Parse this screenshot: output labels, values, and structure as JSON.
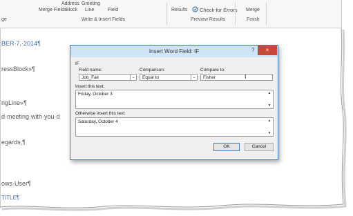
{
  "ribbon": {
    "top_labels": [
      "Merge Fields",
      "Block",
      "Line",
      "Field",
      "Results",
      "Check for Errors",
      "Merge"
    ],
    "top_cut": [
      "Address",
      "Greeting"
    ],
    "groups": [
      "ge",
      "Write & Insert Fields",
      "Preview Results",
      "Finish"
    ]
  },
  "document": {
    "lines": [
      "BER·7,·2014¶",
      "ressBlock»¶",
      "ngLine»¶",
      "d·meeting·with·you·d",
      "egards,¶",
      "ows·User¶",
      "TITLE¶"
    ]
  },
  "dialog": {
    "title": "Insert Word Field: IF",
    "help": "?",
    "close": "×",
    "section": "IF",
    "field_name_label": "Field name:",
    "field_name_value": "Job_Fair",
    "comparison_label": "Comparison:",
    "comparison_value": "Equal to",
    "compare_to_label": "Compare to:",
    "compare_to_value": "Fisher",
    "insert_label": "Insert this text:",
    "insert_value": "Friday, October 3",
    "otherwise_label": "Otherwise insert this text:",
    "otherwise_value": "Saturday, October 4",
    "ok": "OK",
    "cancel": "Cancel"
  }
}
